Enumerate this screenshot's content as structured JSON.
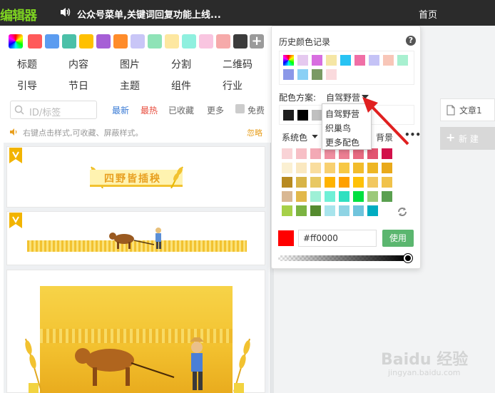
{
  "app": {
    "logo": "编辑器"
  },
  "topbar": {
    "notice": "公众号菜单,关键词回复功能上线...",
    "nav_home": "首页"
  },
  "palette": [
    "#ff5a5a",
    "#5b9cf0",
    "#4bc0a8",
    "#ffc000",
    "#a65fd6",
    "#ff8c2a",
    "#c9c6f7",
    "#8fe3b7",
    "#fde7a0",
    "#8ff0df",
    "#f9c5e0",
    "#f6aaaa",
    "#3b3b3b"
  ],
  "categories": {
    "row1": [
      "标题",
      "内容",
      "图片",
      "分割",
      "二维码"
    ],
    "row2": [
      "引导",
      "节日",
      "主题",
      "组件",
      "行业"
    ]
  },
  "search": {
    "placeholder": "ID/标签"
  },
  "filters": {
    "latest": "最新",
    "hot": "最热",
    "collected": "已收藏",
    "more": "更多",
    "free": "免费"
  },
  "tip": {
    "text": "右键点击样式,可收藏、屏蔽样式。",
    "ignore": "忽略"
  },
  "cards": {
    "card1_title": "四野皆插秧"
  },
  "picker": {
    "history_label": "历史颜色记录",
    "history_colors": [
      "#e5c9ef",
      "#d86ee0",
      "#f5e6a5",
      "#28c3f3",
      "#f06fa6",
      "#c5c3f6",
      "#f8c6b8",
      "#a8f0d0",
      "#8b98e8",
      "#8ad0f5",
      "#7a9a64",
      "#fadadd"
    ],
    "scheme_label": "配色方案:",
    "scheme_value": "自驾野营",
    "scheme_colors": [
      "#1e1e1e",
      "#000000",
      "#c0c0c0"
    ],
    "system_label": "系统色",
    "partial_tab": "背景",
    "more_icon": "more-dots-icon",
    "grid_colors": [
      [
        "#f9d3d6",
        "#f7bfc6",
        "#f3a9b5",
        "#f08ea0",
        "#ec7e92",
        "#e86a81",
        "#e25470",
        "#d2114a"
      ],
      [
        "#fbf0d2",
        "#fae8c0",
        "#f9dd9e",
        "#f8d070",
        "#f7c845",
        "#f2bc2c",
        "#eeb624",
        "#e9a91a"
      ],
      [
        "#b88a20",
        "#d8b447",
        "#e8c862",
        "#ffb300",
        "#ffa000",
        "#ffc107",
        "#f2c860",
        "#f1c24a"
      ],
      [
        "#d9b893",
        "#e2b84a",
        "#9ef0d6",
        "#6ff0d6",
        "#30e0c0",
        "#00e040",
        "#9cc97a",
        "#5aa050"
      ],
      [
        "#a6d048",
        "#7cb342",
        "#558b2f",
        "#a8e4ec",
        "#8fd4e4",
        "#70c4dc",
        "#00acc1",
        "#cfd8dc"
      ]
    ],
    "current_hex": "#ff0000",
    "current_color": "#ff0000",
    "use_label": "使用"
  },
  "dropdown": {
    "items": [
      "自驾野营",
      "织巢鸟",
      "更多配色"
    ]
  },
  "sidebar": {
    "article_tab": "文章1",
    "new_button": "新 建"
  },
  "watermark": {
    "text": "Baidu 经验",
    "sub": "jingyan.baidu.com"
  }
}
